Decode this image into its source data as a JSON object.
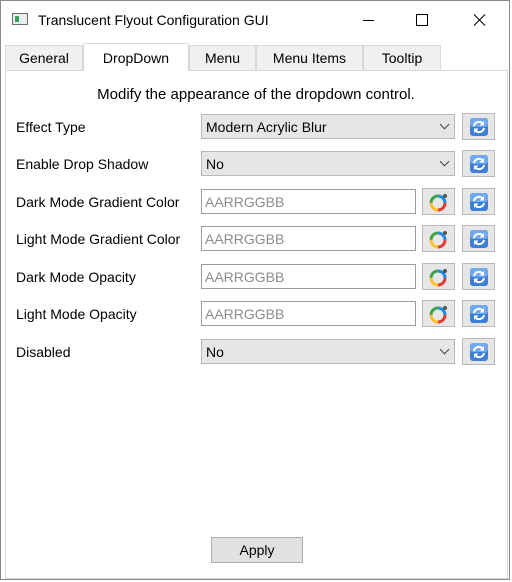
{
  "window": {
    "title": "Translucent Flyout Configuration GUI"
  },
  "tabs": [
    {
      "label": "General"
    },
    {
      "label": "DropDown"
    },
    {
      "label": "Menu"
    },
    {
      "label": "Menu Items"
    },
    {
      "label": "Tooltip"
    }
  ],
  "active_tab": "DropDown",
  "panel": {
    "heading": "Modify the appearance of the dropdown control.",
    "rows": [
      {
        "label": "Effect Type",
        "kind": "select",
        "value": "Modern Acrylic Blur"
      },
      {
        "label": "Enable Drop Shadow",
        "kind": "select",
        "value": "No"
      },
      {
        "label": "Dark Mode Gradient Color",
        "kind": "text",
        "placeholder": "AARRGGBB"
      },
      {
        "label": "Light Mode Gradient Color",
        "kind": "text",
        "placeholder": "AARRGGBB"
      },
      {
        "label": "Dark Mode Opacity",
        "kind": "text",
        "placeholder": "AARRGGBB"
      },
      {
        "label": "Light Mode Opacity",
        "kind": "text",
        "placeholder": "AARRGGBB"
      },
      {
        "label": "Disabled",
        "kind": "select",
        "value": "No"
      }
    ],
    "apply_label": "Apply"
  },
  "icons": {
    "color_picker": "color-wheel-icon",
    "reset": "refresh-icon"
  }
}
